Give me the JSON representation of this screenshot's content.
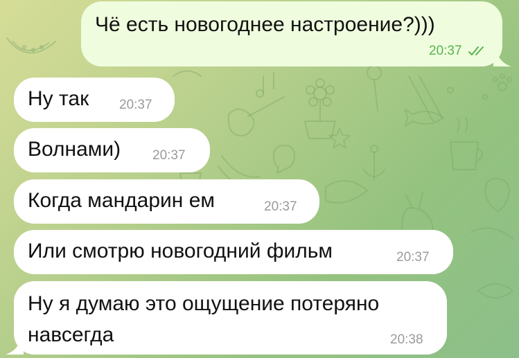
{
  "chat": {
    "colors": {
      "background_start": "#d6dd97",
      "background_end": "#8cbf8a",
      "incoming_bubble": "#ffffff",
      "outgoing_bubble": "#effdde",
      "outgoing_time": "#58b34e",
      "incoming_time": "#9a9a9a"
    },
    "messages": [
      {
        "direction": "outgoing",
        "text": "Чё есть новогоднее настроение?)))",
        "time": "20:37",
        "status_icon": "double-check-read-icon"
      },
      {
        "direction": "incoming",
        "text": "Ну так",
        "time": "20:37"
      },
      {
        "direction": "incoming",
        "text": "Волнами)",
        "time": "20:37"
      },
      {
        "direction": "incoming",
        "text": "Когда мандарин ем",
        "time": "20:37"
      },
      {
        "direction": "incoming",
        "text": "Или смотрю новогодний фильм",
        "time": "20:37"
      },
      {
        "direction": "incoming",
        "text_line1": "Ну я думаю это ощущение потеряно",
        "text_line2": "навсегда",
        "time": "20:38"
      }
    ]
  }
}
